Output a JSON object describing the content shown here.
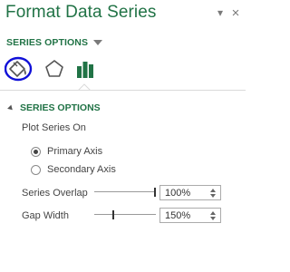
{
  "pane": {
    "title": "Format Data Series",
    "pin_icon": "▾",
    "close_icon": "×"
  },
  "options_menu": {
    "label": "SERIES OPTIONS"
  },
  "tabs": [
    {
      "name": "fill-and-line",
      "icon": "paint-bucket-icon",
      "active": true
    },
    {
      "name": "effects",
      "icon": "pentagon-icon",
      "active": false
    },
    {
      "name": "series-options",
      "icon": "bar-chart-icon",
      "active": false
    }
  ],
  "section": {
    "title": "SERIES OPTIONS",
    "plot_on_label": "Plot Series On",
    "primary_axis": {
      "label": "Primary Axis",
      "selected": true
    },
    "secondary_axis": {
      "label": "Secondary Axis",
      "selected": false
    },
    "series_overlap": {
      "label": "Series Overlap",
      "value": "100%",
      "fraction": 1.0
    },
    "gap_width": {
      "label": "Gap Width",
      "value": "150%",
      "fraction": 0.3
    }
  },
  "colors": {
    "accent": "#217346",
    "highlight_ring": "#1010d8"
  }
}
